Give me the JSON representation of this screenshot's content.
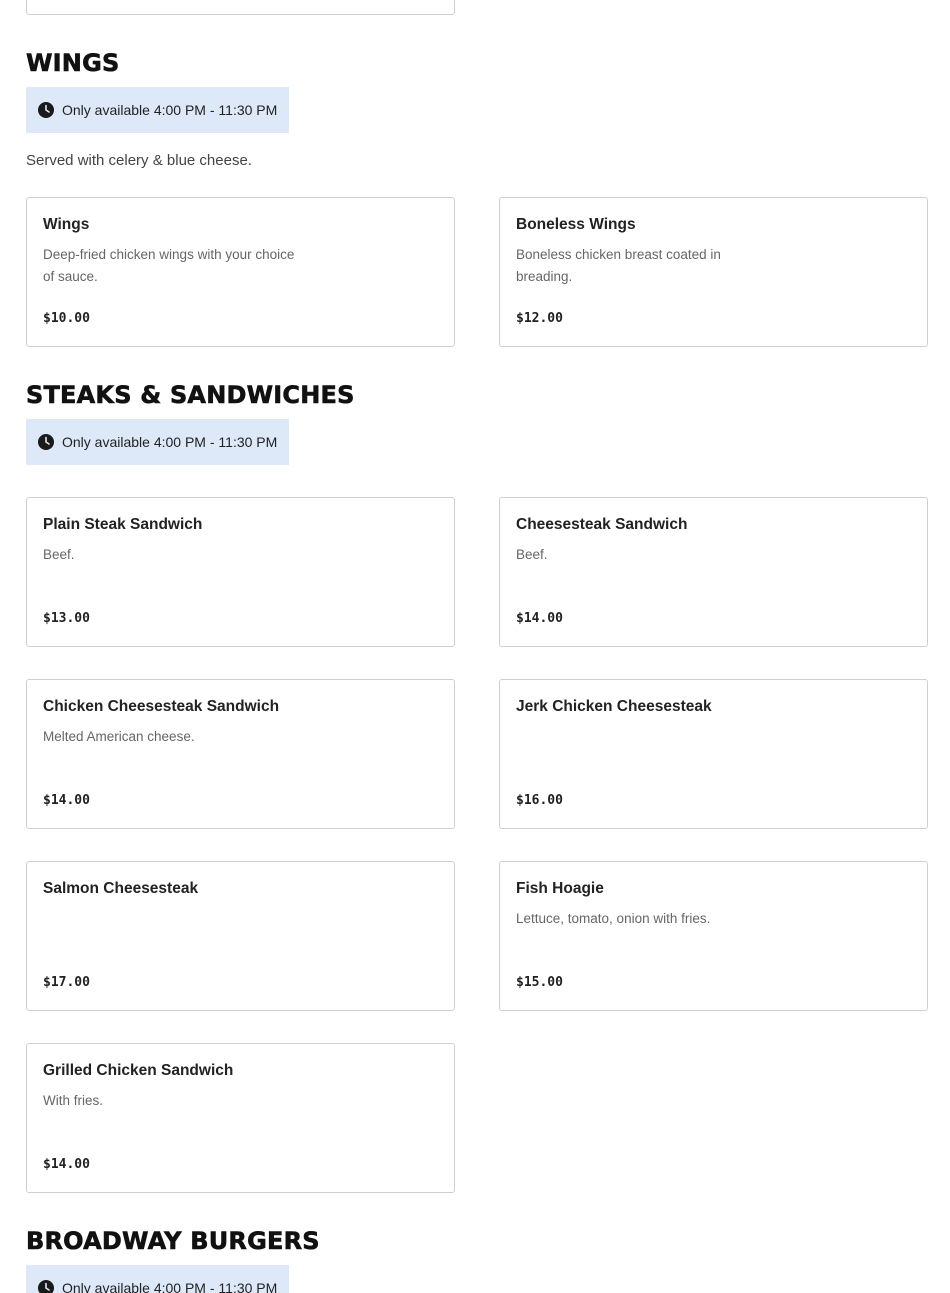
{
  "sections": {
    "wings": {
      "title": "WINGS",
      "availability": "Only available 4:00 PM - 11:30 PM",
      "description": "Served with celery & blue cheese.",
      "items": [
        {
          "name": "Wings",
          "description": "Deep-fried chicken wings with your choice of sauce.",
          "price": "$10.00"
        },
        {
          "name": "Boneless Wings",
          "description": "Boneless chicken breast coated in breading.",
          "price": "$12.00"
        }
      ]
    },
    "steaks": {
      "title": "STEAKS & SANDWICHES",
      "availability": "Only available 4:00 PM - 11:30 PM",
      "items": [
        {
          "name": "Plain Steak Sandwich",
          "description": "Beef.",
          "price": "$13.00"
        },
        {
          "name": "Cheesesteak Sandwich",
          "description": "Beef.",
          "price": "$14.00"
        },
        {
          "name": "Chicken Cheesesteak Sandwich",
          "description": "Melted American cheese.",
          "price": "$14.00"
        },
        {
          "name": "Jerk Chicken Cheesesteak",
          "description": "",
          "price": "$16.00"
        },
        {
          "name": "Salmon Cheesesteak",
          "description": "",
          "price": "$17.00"
        },
        {
          "name": "Fish Hoagie",
          "description": "Lettuce, tomato, onion with fries.",
          "price": "$15.00"
        },
        {
          "name": "Grilled Chicken Sandwich",
          "description": "With fries.",
          "price": "$14.00"
        }
      ]
    },
    "burgers": {
      "title": "BROADWAY BURGERS",
      "availability": "Only available 4:00 PM - 11:30 PM"
    }
  },
  "icons": {
    "availability": "clock-icon"
  },
  "colors": {
    "availability_bg": "#dde8f8",
    "card_border": "#cfcfcf"
  }
}
